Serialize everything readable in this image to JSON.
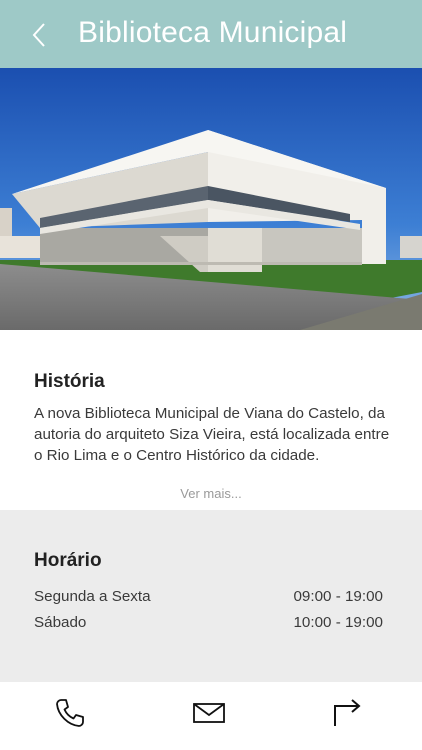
{
  "header": {
    "title": "Biblioteca Municipal",
    "back_icon": "chevron-left-icon",
    "background_color": "#9ec9c7"
  },
  "hero": {
    "image_description": "building-photo"
  },
  "history": {
    "title": "História",
    "text": "A nova Biblioteca Municipal de Viana do Castelo, da autoria do arquiteto Siza Vieira, está localizada entre o Rio Lima e o Centro Histórico da cidade.",
    "see_more_label": "Ver mais..."
  },
  "hours": {
    "title": "Horário",
    "rows": [
      {
        "days": "Segunda a Sexta",
        "time": "09:00 - 19:00"
      },
      {
        "days": "Sábado",
        "time": "10:00 - 19:00"
      }
    ],
    "background_color": "#ececec"
  },
  "bottom_bar": {
    "icons": [
      "phone-icon",
      "mail-icon",
      "directions-icon"
    ]
  }
}
